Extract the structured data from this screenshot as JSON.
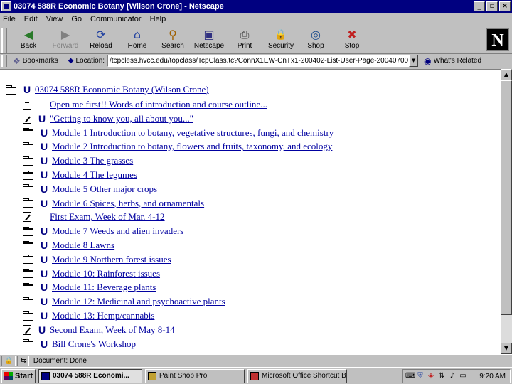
{
  "window": {
    "title": "03074 588R Economic Botany [Wilson Crone] - Netscape",
    "controls": [
      "_",
      "▫",
      "×"
    ]
  },
  "menu": [
    "File",
    "Edit",
    "View",
    "Go",
    "Communicator",
    "Help"
  ],
  "toolbar": {
    "buttons": [
      {
        "label": "Back",
        "icon": "back-arrow-icon",
        "glyph": "◀"
      },
      {
        "label": "Forward",
        "icon": "forward-arrow-icon",
        "glyph": "▶"
      },
      {
        "label": "Reload",
        "icon": "reload-icon",
        "glyph": "⟳"
      },
      {
        "label": "Home",
        "icon": "home-icon",
        "glyph": "⌂"
      },
      {
        "label": "Search",
        "icon": "search-icon",
        "glyph": "⚲"
      },
      {
        "label": "Netscape",
        "icon": "netscape-icon",
        "glyph": "▣"
      },
      {
        "label": "Print",
        "icon": "print-icon",
        "glyph": "⎙"
      },
      {
        "label": "Security",
        "icon": "lock-icon",
        "glyph": "🔒"
      },
      {
        "label": "Shop",
        "icon": "shop-icon",
        "glyph": "◎"
      },
      {
        "label": "Stop",
        "icon": "stop-icon",
        "glyph": "✖"
      }
    ],
    "logo": "N"
  },
  "location_bar": {
    "bookmarks_label": "Bookmarks",
    "location_label": "Location:",
    "url": "/tcpcless.hvcc.edu/topclass/TcpClass.tc?ConnX1EW-CnTx1-200402-List-User-Page-20040700",
    "related_label": "What's Related"
  },
  "content": {
    "root": {
      "label": "03074 588R Economic Botany (Wilson Crone)"
    },
    "items": [
      {
        "icon": "doc",
        "badge": false,
        "label": "Open me first!! Words of introduction and course outline..."
      },
      {
        "icon": "edit",
        "badge": true,
        "label": "\"Getting to know you, all about you...\""
      },
      {
        "icon": "folder",
        "badge": true,
        "label": "Module 1  Introduction to botany, vegetative structures, fungi, and chemistry"
      },
      {
        "icon": "folder",
        "badge": true,
        "label": "Module 2  Introduction to botany, flowers and fruits, taxonomy, and ecology"
      },
      {
        "icon": "folder",
        "badge": true,
        "label": "Module 3  The grasses"
      },
      {
        "icon": "folder",
        "badge": true,
        "label": "Module 4  The legumes"
      },
      {
        "icon": "folder",
        "badge": true,
        "label": "Module 5  Other major crops"
      },
      {
        "icon": "folder",
        "badge": true,
        "label": "Module 6  Spices, herbs, and ornamentals"
      },
      {
        "icon": "edit",
        "badge": false,
        "label": "First Exam, Week of Mar. 4-12"
      },
      {
        "icon": "folder",
        "badge": true,
        "label": "Module 7  Weeds and alien invaders"
      },
      {
        "icon": "folder",
        "badge": true,
        "label": "Module 8  Lawns"
      },
      {
        "icon": "folder",
        "badge": true,
        "label": "Module 9  Northern forest issues"
      },
      {
        "icon": "folder",
        "badge": true,
        "label": "Module 10: Rainforest issues"
      },
      {
        "icon": "folder",
        "badge": true,
        "label": "Module 11: Beverage plants"
      },
      {
        "icon": "folder",
        "badge": true,
        "label": "Module 12: Medicinal and psychoactive plants"
      },
      {
        "icon": "folder",
        "badge": true,
        "label": "Module 13: Hemp/cannabis"
      },
      {
        "icon": "edit",
        "badge": true,
        "label": "Second Exam, Week of May 8-14"
      },
      {
        "icon": "folder",
        "badge": true,
        "label": "Bill Crone's Workshop"
      }
    ]
  },
  "status": {
    "text": "Document: Done"
  },
  "taskbar": {
    "start_label": "Start",
    "tasks": [
      {
        "label": "03074 588R Economi...",
        "active": true
      },
      {
        "label": "Paint Shop Pro",
        "active": false
      },
      {
        "label": "Microsoft Office Shortcut Bar",
        "active": false
      }
    ],
    "clock": "9:20 AM"
  },
  "colors": {
    "titlebar": "#000080",
    "link": "#0000a0",
    "chrome": "#c0c0c0"
  }
}
